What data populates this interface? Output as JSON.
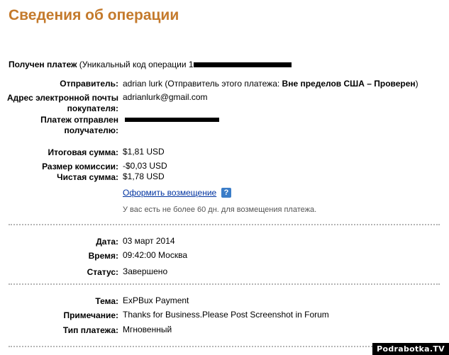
{
  "title": "Сведения об операции",
  "received": {
    "label": "Получен платеж",
    "text": " (Уникальный код операции 1"
  },
  "sender": {
    "label": "Отправитель:",
    "value_prefix": "adrian lurk (Отправитель этого платежа: ",
    "value_bold": "Вне пределов США – Проверен",
    "value_suffix": ")"
  },
  "buyer_email": {
    "label_line1": "Адрес электронной почты",
    "label_line2": "покупателя:",
    "value": "adrianlurk@gmail.com"
  },
  "sent_to": {
    "label_line1": "Платеж отправлен",
    "label_line2": "получателю:"
  },
  "amounts": {
    "total_label": "Итоговая сумма:",
    "total_value": "$1,81 USD",
    "fee_label": "Размер комиссии:",
    "fee_value": "-$0,03 USD",
    "net_label": "Чистая сумма:",
    "net_value": "$1,78 USD"
  },
  "refund": {
    "link": "Оформить возмещение",
    "help_icon": "?",
    "note": "У вас есть не более 60 дн. для возмещения платежа."
  },
  "details": {
    "date_label": "Дата:",
    "date_value": "03 март 2014",
    "time_label": "Время:",
    "time_value": "09:42:00 Москва",
    "status_label": "Статус:",
    "status_value": "Завершено"
  },
  "payment": {
    "subject_label": "Тема:",
    "subject_value": "ExPBux Payment",
    "note_label": "Примечание:",
    "note_value": "Thanks for Business.Please Post Screenshot in Forum",
    "type_label": "Тип платежа:",
    "type_value": "Мгновенный"
  },
  "watermark": "Podrabotka.TV"
}
